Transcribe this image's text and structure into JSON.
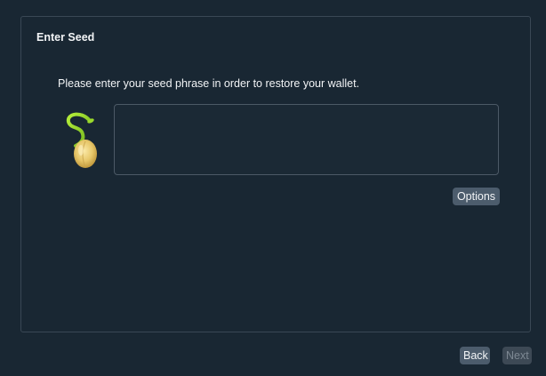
{
  "panel": {
    "title": "Enter Seed",
    "instruction": "Please enter your seed phrase in order to restore your wallet.",
    "seed_input": {
      "value": "",
      "placeholder": ""
    },
    "options_label": "Options"
  },
  "footer": {
    "back_label": "Back",
    "next_label": "Next",
    "next_enabled": false
  },
  "icons": {
    "seed": "sprouting-seed-icon"
  },
  "colors": {
    "background": "#192733",
    "button": "#4c5c6c",
    "button_disabled": "#3d4955",
    "sprout_green": "#8bd12a",
    "seed_gold": "#e7c76a"
  }
}
